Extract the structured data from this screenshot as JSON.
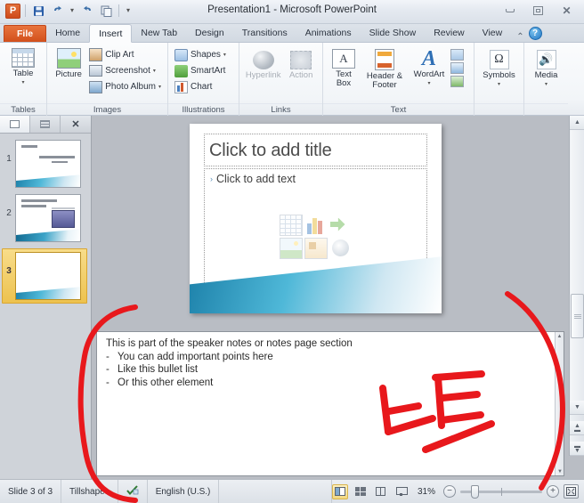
{
  "window": {
    "title": "Presentation1 - Microsoft PowerPoint",
    "app_logo": "powerpoint-logo",
    "quick_access": [
      {
        "name": "save",
        "glyph": "ὋE"
      },
      {
        "name": "undo",
        "glyph": "↶"
      },
      {
        "name": "redo",
        "glyph": "↻"
      },
      {
        "name": "duplicate",
        "glyph": "❐"
      },
      {
        "name": "customize",
        "glyph": "▾"
      }
    ],
    "controls": {
      "minimize": "Minimize",
      "restore": "Restore",
      "close": "Close"
    }
  },
  "tabs": [
    {
      "label": "File",
      "kind": "file"
    },
    {
      "label": "Home",
      "kind": "normal"
    },
    {
      "label": "Insert",
      "kind": "active"
    },
    {
      "label": "New Tab",
      "kind": "normal"
    },
    {
      "label": "Design",
      "kind": "normal"
    },
    {
      "label": "Transitions",
      "kind": "normal"
    },
    {
      "label": "Animations",
      "kind": "normal"
    },
    {
      "label": "Slide Show",
      "kind": "normal"
    },
    {
      "label": "Review",
      "kind": "normal"
    },
    {
      "label": "View",
      "kind": "normal"
    }
  ],
  "tab_extras": {
    "minimize_ribbon": "⌃",
    "help": "?"
  },
  "ribbon": {
    "groups": [
      {
        "label": "Tables",
        "big": [
          {
            "label": "Table",
            "arrow": "▾",
            "icon": "table-icon"
          }
        ],
        "small": []
      },
      {
        "label": "Images",
        "big": [
          {
            "label": "Picture",
            "arrow": "",
            "icon": "picture-icon"
          }
        ],
        "small": [
          {
            "label": "Clip Art",
            "arrow": "",
            "icon": "clip-art-icon"
          },
          {
            "label": "Screenshot",
            "arrow": "▾",
            "icon": "screenshot-icon"
          },
          {
            "label": "Photo Album",
            "arrow": "▾",
            "icon": "photo-album-icon"
          }
        ]
      },
      {
        "label": "Illustrations",
        "big": [],
        "small": [
          {
            "label": "Shapes",
            "arrow": "▾",
            "icon": "shapes-icon"
          },
          {
            "label": "SmartArt",
            "arrow": "",
            "icon": "smartart-icon"
          },
          {
            "label": "Chart",
            "arrow": "",
            "icon": "chart-icon"
          }
        ]
      },
      {
        "label": "Links",
        "big": [
          {
            "label": "Hyperlink",
            "arrow": "",
            "icon": "hyperlink-icon",
            "disabled": true
          },
          {
            "label": "Action",
            "arrow": "",
            "icon": "action-icon",
            "disabled": true
          }
        ],
        "small": []
      },
      {
        "label": "Text",
        "big": [
          {
            "label": "Text Box",
            "arrow": "",
            "icon": "text-box-icon"
          },
          {
            "label": "Header & Footer",
            "arrow": "",
            "icon": "header-footer-icon"
          },
          {
            "label": "WordArt",
            "arrow": "▾",
            "icon": "wordart-icon"
          }
        ],
        "small": []
      },
      {
        "label": "",
        "big": [
          {
            "label": "Symbols",
            "arrow": "▾",
            "icon": "symbol-omega-icon"
          }
        ],
        "small": []
      },
      {
        "label": "",
        "big": [
          {
            "label": "Media",
            "arrow": "▾",
            "icon": "media-icon"
          }
        ],
        "small": []
      }
    ]
  },
  "slide_panel": {
    "tabs": [
      {
        "label": "Slides",
        "icon": "slides-tab-icon",
        "active": true
      },
      {
        "label": "Outline",
        "icon": "outline-tab-icon",
        "active": false
      }
    ],
    "close": "✕",
    "thumbnails": [
      {
        "number": "1",
        "selected": false,
        "title": "Belrist",
        "subtitle": "Business Intelligence"
      },
      {
        "number": "2",
        "selected": false,
        "title": "Several Slide Type",
        "subtitle": "with beginning"
      },
      {
        "number": "3",
        "selected": true,
        "title": "",
        "subtitle": ""
      }
    ]
  },
  "slide": {
    "title_placeholder": "Click to add title",
    "body_placeholder": "Click to add text",
    "body_bullet": "›",
    "content_icons": [
      "insert-table-icon",
      "insert-chart-icon",
      "insert-smartart-icon",
      "insert-picture-icon",
      "insert-clipart-icon",
      "insert-media-icon"
    ]
  },
  "notes": {
    "heading": "This is part of the speaker notes or notes page section",
    "bullet_char": "-",
    "items": [
      "You can add important points here",
      "Like this bullet list",
      "Or this other element"
    ]
  },
  "annotation": {
    "text": "노트",
    "color": "#e8181c",
    "shape": "hand-drawn-oval-bracket-around-notes-pane"
  },
  "scrollbar": {
    "up": "▲",
    "down": "▼",
    "previous_slide": "▲",
    "next_slide": "▼"
  },
  "status_bar": {
    "slide_count": "Slide 3 of 3",
    "theme": "Tillshapes",
    "spell_icon": "spell-check-icon",
    "language": "English (U.S.)",
    "views": [
      {
        "label": "Normal",
        "icon": "normal-view-icon",
        "active": true
      },
      {
        "label": "Slide Sorter",
        "icon": "slide-sorter-icon",
        "active": false
      },
      {
        "label": "Reading View",
        "icon": "reading-view-icon",
        "active": false
      },
      {
        "label": "Slide Show",
        "icon": "slide-show-icon",
        "active": false
      }
    ],
    "zoom": "31%",
    "zoom_out": "−",
    "zoom_in": "+",
    "fit_to_window": "fit-slide-icon"
  }
}
